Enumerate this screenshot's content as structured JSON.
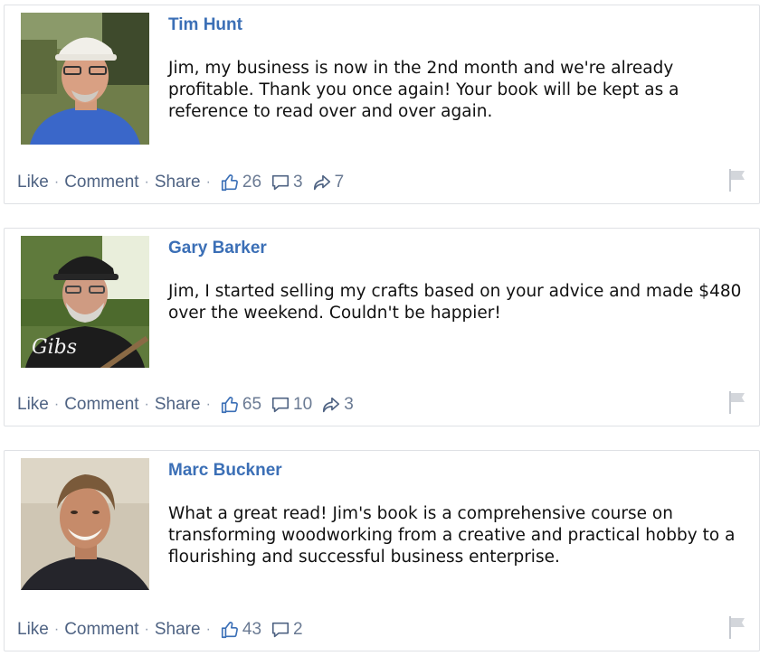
{
  "posts": [
    {
      "author": "Tim Hunt",
      "text": "Jim, my business is now in the 2nd month and we're already profitable. Thank you once again! Your book will be kept as a reference to read over and over again.",
      "like_label": "Like",
      "comment_label": "Comment",
      "share_label": "Share",
      "separator": "·",
      "likes": "26",
      "comments": "3",
      "shares": "7"
    },
    {
      "author": "Gary Barker",
      "text": "Jim, I started selling my crafts based on your advice and made $480 over the weekend. Couldn't be happier!",
      "like_label": "Like",
      "comment_label": "Comment",
      "share_label": "Share",
      "separator": "·",
      "likes": "65",
      "comments": "10",
      "shares": "3",
      "avatar_shirt_text": "Gibs"
    },
    {
      "author": "Marc Buckner",
      "text": "What a great read! Jim's book is a comprehensive course on transforming woodworking from a creative and practical hobby to a flourishing and successful business enterprise.",
      "like_label": "Like",
      "comment_label": "Comment",
      "share_label": "Share",
      "separator": "·",
      "likes": "43",
      "comments": "2"
    }
  ],
  "colors": {
    "author_link": "#3b6fb6",
    "action_text": "#4f6383",
    "card_border": "#dfe1e5"
  },
  "icons": [
    "thumbs-up-icon",
    "comment-bubble-icon",
    "share-arrow-icon",
    "flag-icon"
  ]
}
